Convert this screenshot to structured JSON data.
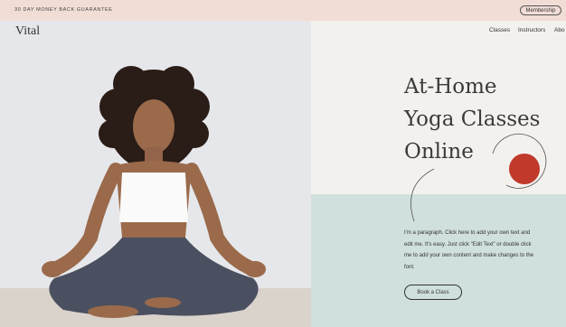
{
  "topbar": {
    "guarantee_text": "30 DAY MONEY BACK GUARANTEE",
    "membership_label": "Membership"
  },
  "brand": {
    "logo_text": "Vital"
  },
  "nav": {
    "classes": "Classes",
    "instructors": "Instructors",
    "about": "Abo"
  },
  "hero": {
    "title_lines": [
      "At-Home",
      "Yoga Classes",
      "Online"
    ],
    "paragraph": "I'm a paragraph. Click here to add your own text and edit me. It's easy. Just click “Edit Text” or double click me to add your own content and make changes to the font.",
    "cta_label": "Book a Class"
  },
  "colors": {
    "topbar_bg": "#f2ddd6",
    "mint": "#d0e0dd",
    "accent_circle": "#c0392b",
    "text": "#3b3b3b"
  }
}
